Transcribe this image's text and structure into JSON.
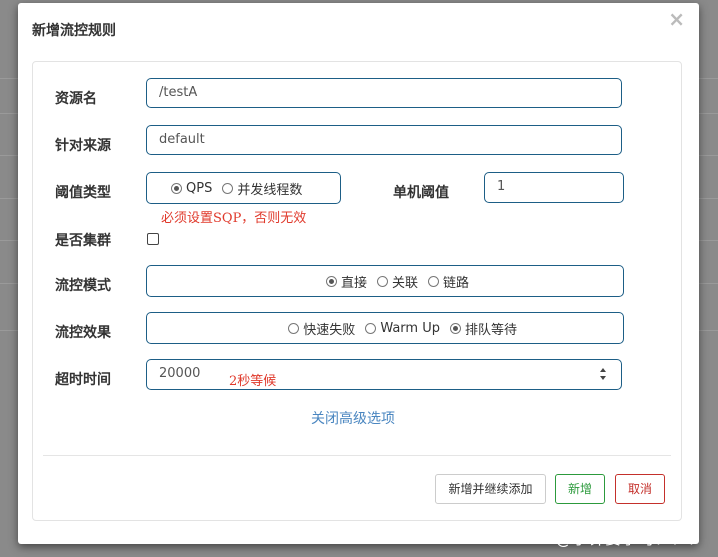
{
  "modal": {
    "title": "新增流控规则",
    "close_label": "×"
  },
  "form": {
    "resource_name": {
      "label": "资源名",
      "value": "/testA"
    },
    "limit_app": {
      "label": "针对来源",
      "value": "default"
    },
    "grade": {
      "label": "阈值类型",
      "options": [
        "QPS",
        "并发线程数"
      ],
      "selected": "QPS",
      "annotation": "必须设置SQP，否则无效"
    },
    "threshold": {
      "label": "单机阈值",
      "value": "1"
    },
    "cluster": {
      "label": "是否集群",
      "checked": false
    },
    "strategy": {
      "label": "流控模式",
      "options": [
        "直接",
        "关联",
        "链路"
      ],
      "selected": "直接"
    },
    "control_behavior": {
      "label": "流控效果",
      "options": [
        "快速失败",
        "Warm Up",
        "排队等待"
      ],
      "selected": "排队等待"
    },
    "timeout": {
      "label": "超时时间",
      "value": "20000",
      "annotation": "2秒等候"
    },
    "advanced_link": "关闭高级选项"
  },
  "buttons": {
    "add_continue": "新增并继续添加",
    "add": "新增",
    "cancel": "取消"
  },
  "watermark": "CSDN @小钟要学习！！！",
  "colors": {
    "border": "#1d5e86",
    "success": "#2c9a3c",
    "danger": "#c4302b",
    "annotation": "#e0392b",
    "link": "#4a86c0"
  }
}
